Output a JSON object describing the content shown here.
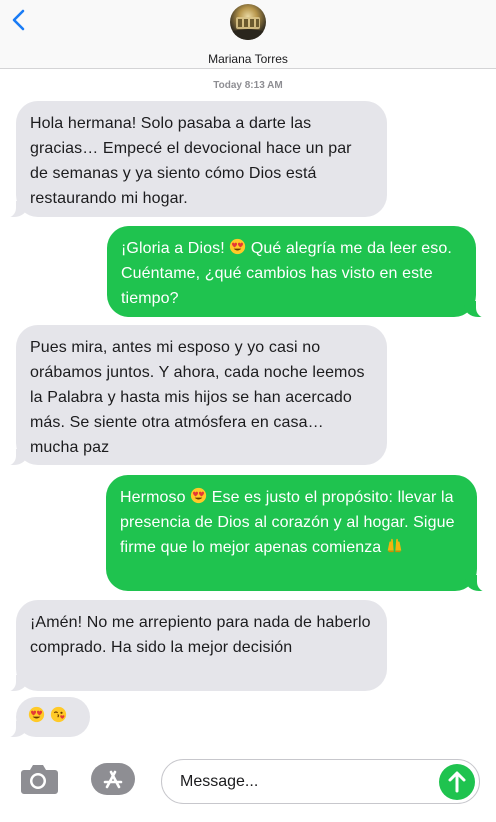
{
  "header": {
    "back_icon": "chevron-left-icon",
    "contact_name": "Mariana Torres",
    "accent_color": "#1a7cf5"
  },
  "conversation": {
    "timestamp": "Today 8:13 AM",
    "messages": [
      {
        "direction": "incoming",
        "parts": [
          "Hola hermana! Solo pasaba a darte las gracias… Empecé el devocional hace un par de semanas y ya siento cómo Dios está restaurando mi hogar."
        ]
      },
      {
        "direction": "outgoing",
        "parts": [
          "¡Gloria a Dios! ",
          " Qué alegría me da leer eso. Cuéntame, ¿qué cambios has visto en este tiempo?"
        ],
        "emojis": [
          "heart-eyes-emoji"
        ]
      },
      {
        "direction": "incoming",
        "parts": [
          "Pues mira, antes mi esposo y yo casi no orábamos juntos. Y ahora, cada noche leemos la Palabra y hasta mis hijos se han acercado más. Se siente otra atmósfera en casa… mucha paz"
        ]
      },
      {
        "direction": "outgoing",
        "parts": [
          "Hermoso ",
          " Ese es justo el propósito: llevar la presencia de Dios al corazón y al hogar. Sigue firme que lo mejor apenas comienza "
        ],
        "emojis": [
          "heart-eyes-emoji",
          "raised-hands-emoji"
        ]
      },
      {
        "direction": "incoming",
        "parts": [
          "¡Amén! No me arrepiento para nada de haberlo comprado. Ha sido la mejor decisión"
        ]
      },
      {
        "direction": "incoming",
        "parts": [],
        "emojis": [
          "heart-eyes-emoji",
          "kissing-face-emoji"
        ]
      }
    ],
    "incoming_color": "#e5e5ea",
    "outgoing_color": "#1fc34f"
  },
  "composer": {
    "camera_icon": "camera-icon",
    "apps_icon": "app-store-icon",
    "placeholder": "Message...",
    "send_icon": "send-arrow-icon"
  }
}
